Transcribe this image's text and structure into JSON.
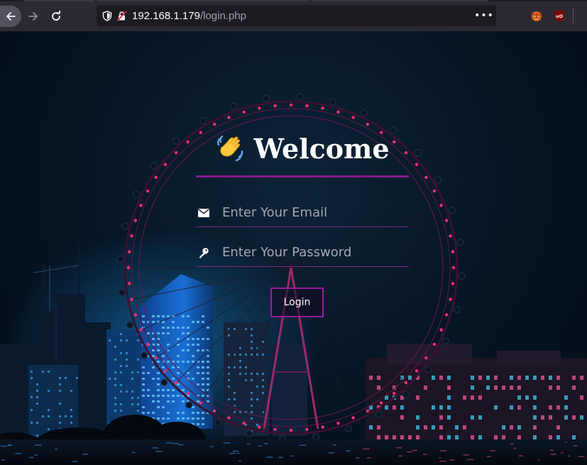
{
  "browser": {
    "url_host": "192.168.1.179",
    "url_path": "/login.php",
    "more_label": "•••"
  },
  "login": {
    "title": "Welcome",
    "email_placeholder": "Enter Your Email",
    "password_placeholder": "Enter Your Password",
    "button_label": "Login"
  },
  "icons": {
    "back": "arrow-left-icon",
    "forward": "arrow-right-icon",
    "reload": "reload-icon",
    "shield": "shield-icon",
    "insecure": "insecure-lock-icon",
    "extension_1": "fox-extension-icon",
    "extension_2": "ublock-icon",
    "email": "envelope-icon",
    "password": "key-icon",
    "title_emoji": "waving-hand-icon"
  },
  "colors": {
    "accent": "#8a1a8c",
    "button_border": "#9a1aa0",
    "wheel_lights": "#ff2e74"
  }
}
